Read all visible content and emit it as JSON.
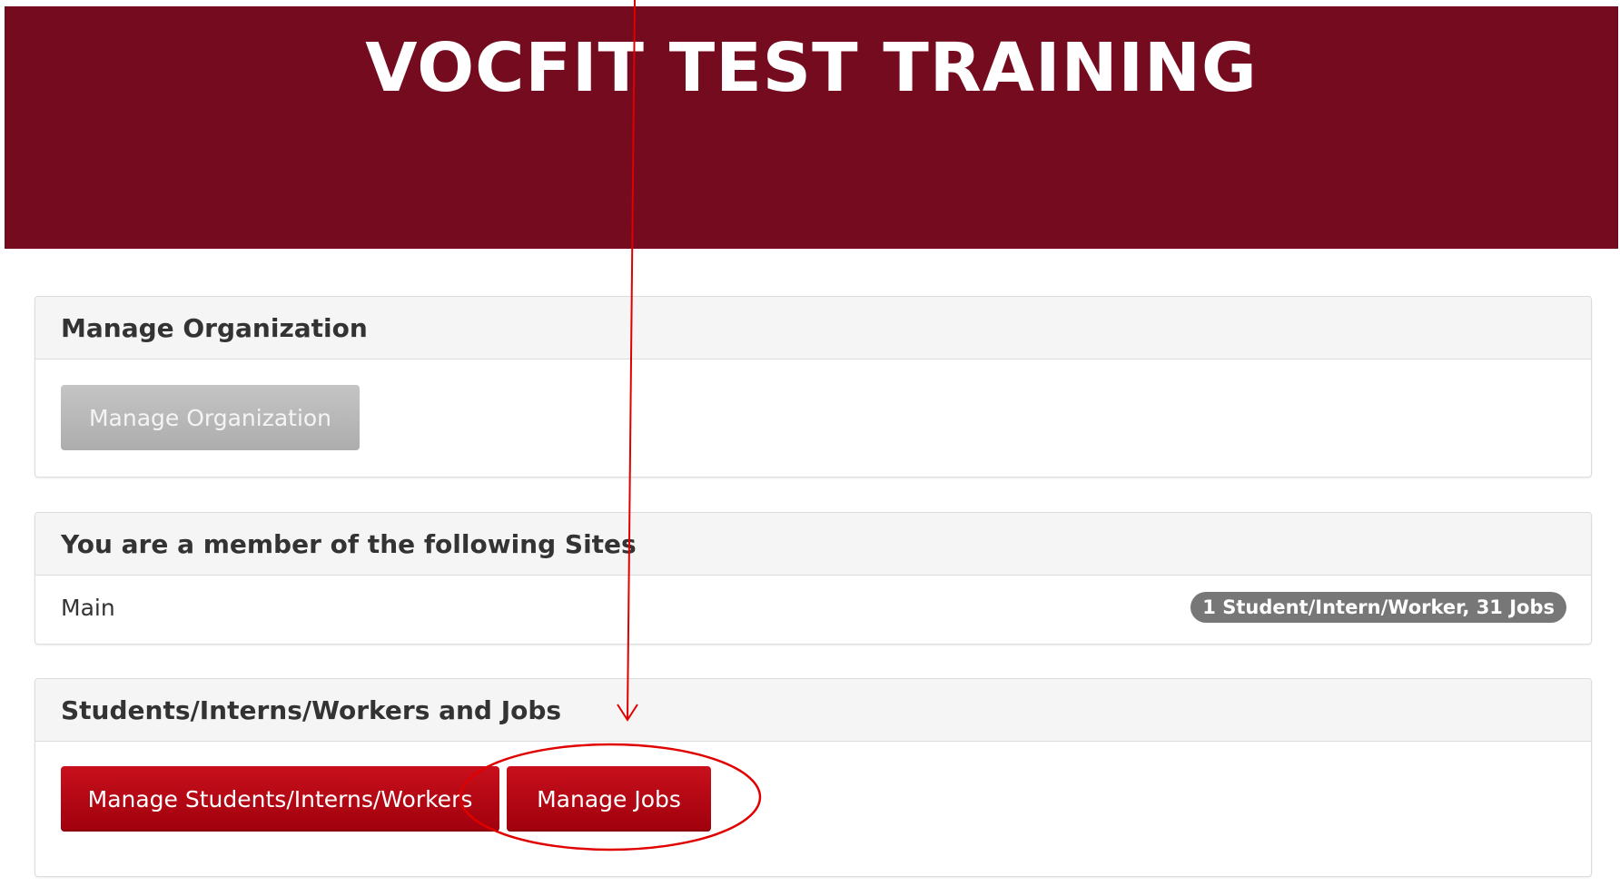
{
  "header": {
    "title": "VOCFIT TEST TRAINING"
  },
  "manage_org": {
    "heading": "Manage Organization",
    "button_label": "Manage Organization"
  },
  "sites": {
    "heading": "You are a member of the following Sites",
    "items": [
      {
        "name": "Main",
        "badge": "1 Student/Intern/Worker, 31 Jobs"
      }
    ]
  },
  "students_jobs": {
    "heading": "Students/Interns/Workers and Jobs",
    "manage_students_label": "Manage Students/Interns/Workers",
    "manage_jobs_label": "Manage Jobs"
  },
  "annotation": {
    "color": "#e00000",
    "target": "Manage Jobs"
  },
  "colors": {
    "banner": "#750b1e",
    "primary_button": "#b50715",
    "disabled_button": "#b8b8b8",
    "badge": "#777777"
  }
}
